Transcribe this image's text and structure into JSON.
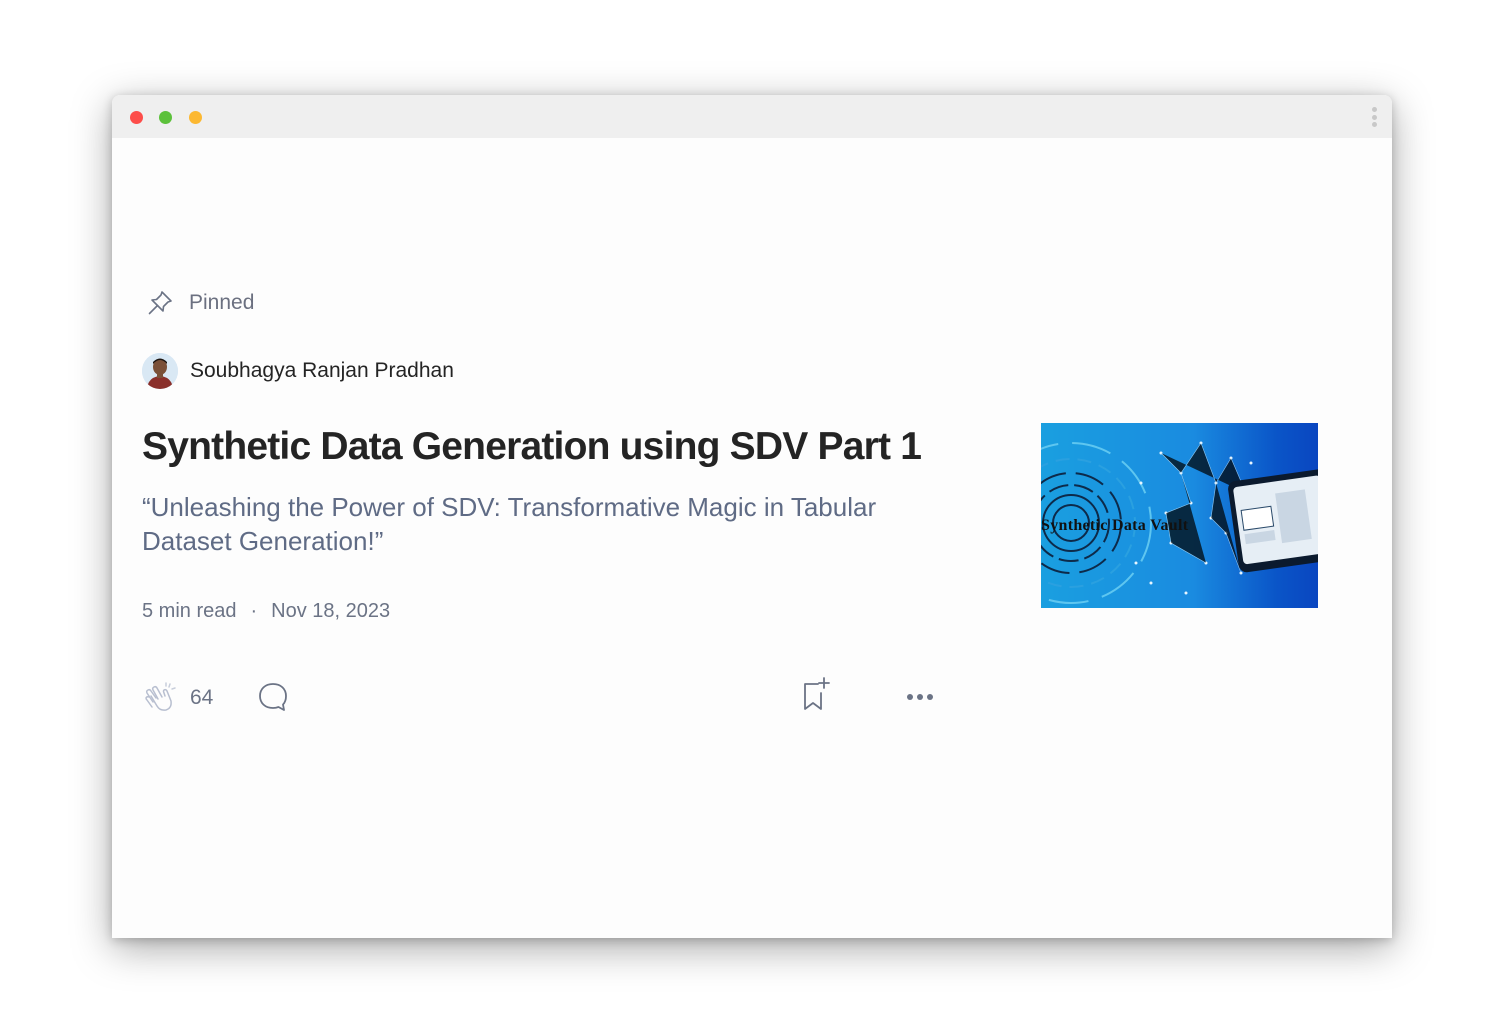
{
  "post": {
    "pinned_label": "Pinned",
    "author": "Soubhagya Ranjan Pradhan",
    "title": "Synthetic Data Generation using SDV Part 1",
    "subtitle": "“Unleashing the Power of SDV: Transformative Magic in Tabular Dataset Generation!”",
    "read_time": "5 min read",
    "separator": "·",
    "date": "Nov 18, 2023",
    "claps": "64",
    "thumbnail_text": "Synthetic Data Vault"
  },
  "icons": {
    "pin": "pin-icon",
    "clap": "clap-icon",
    "comment": "comment-icon",
    "bookmark": "bookmark-add-icon",
    "more": "more-icon"
  },
  "colors": {
    "title": "#242424",
    "subtitle": "#5f6b85",
    "meta": "#6b7385",
    "traffic_red": "#fd4d4a",
    "traffic_green": "#5cc13b",
    "traffic_yellow": "#fcb831"
  }
}
